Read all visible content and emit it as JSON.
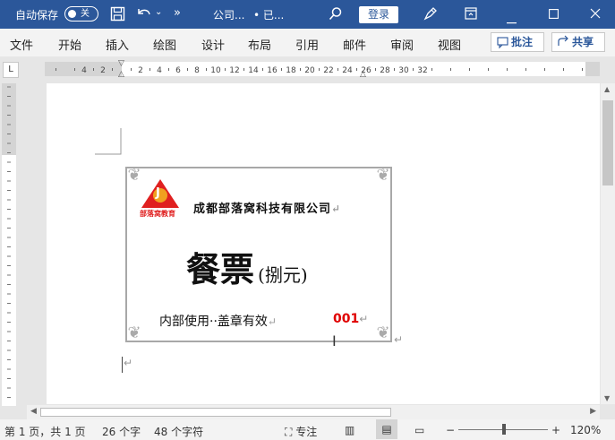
{
  "title_bar": {
    "autosave_label": "自动保存",
    "autosave_state": "关",
    "doc_title": "公司...",
    "doc_status": "• 已...",
    "login_label": "登录",
    "icons": [
      "save-icon",
      "undo-icon",
      "chevron-down-icon",
      "more-icon",
      "search-icon",
      "pen-icon",
      "ribbon-display-icon",
      "minimize-icon",
      "maximize-icon",
      "close-icon"
    ]
  },
  "menu": {
    "items": [
      "文件",
      "开始",
      "插入",
      "绘图",
      "设计",
      "布局",
      "引用",
      "邮件",
      "审阅",
      "视图"
    ],
    "comment_label": "批注",
    "share_label": "共享"
  },
  "ruler": {
    "tab_selector": "L",
    "numbers": [
      "4",
      "2",
      "2",
      "4",
      "6",
      "8",
      "10",
      "12",
      "14",
      "16",
      "18",
      "20",
      "22",
      "24",
      "26",
      "28",
      "30",
      "32"
    ]
  },
  "ticket": {
    "logo_text": "部落窝教育",
    "logo_letter": "J",
    "company": "成都部落窝科技有限公司",
    "title": "餐票",
    "subtitle": "(捌元)",
    "usage": "内部使用··盖章有效",
    "number": "001",
    "paragraph_mark": "↵",
    "colors": {
      "logo_red": "#e02020",
      "logo_orange": "#f0a020",
      "number_red": "#e00000"
    }
  },
  "status": {
    "page": "第 1 页，共 1 页",
    "words": "26 个字",
    "chars": "48 个字符",
    "focus": "专注",
    "zoom": "120%",
    "zoom_minus": "−",
    "zoom_plus": "+"
  }
}
